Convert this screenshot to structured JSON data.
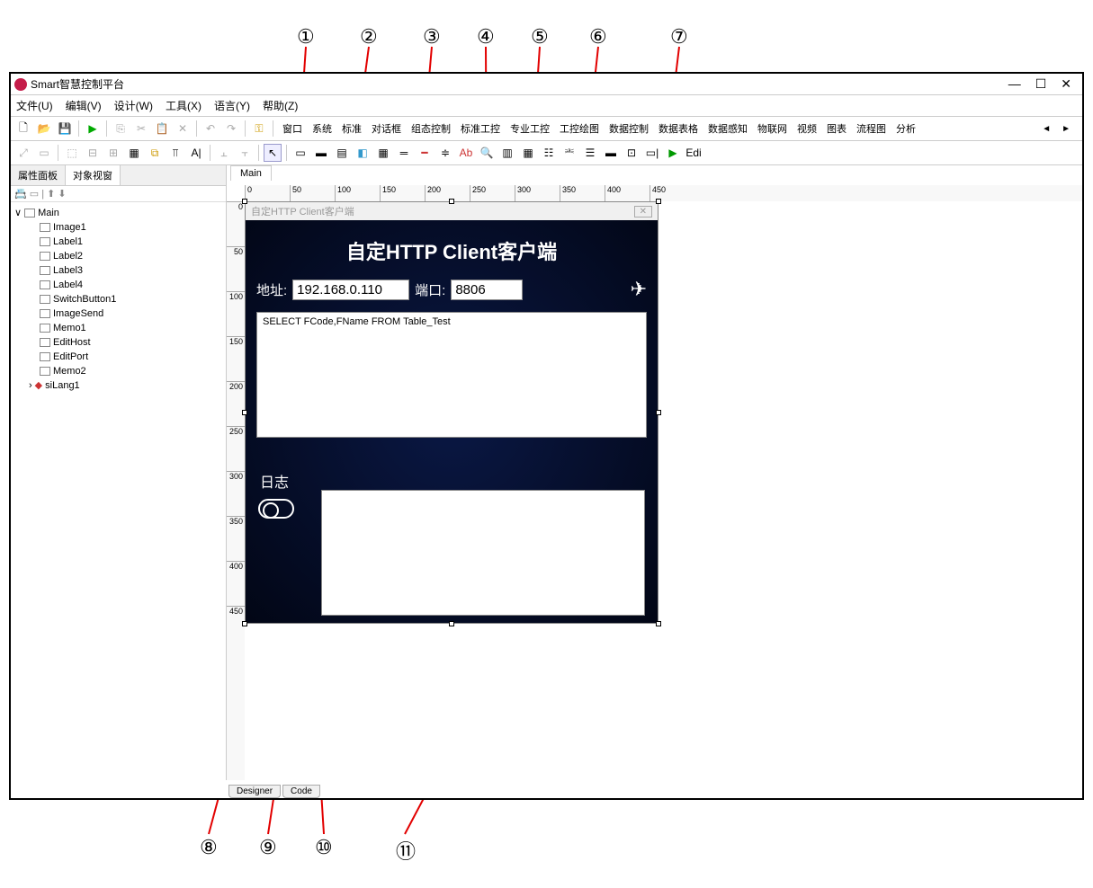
{
  "callouts_top": [
    "①",
    "②",
    "③",
    "④",
    "⑤",
    "⑥",
    "⑦"
  ],
  "callouts_bottom": [
    "⑧",
    "⑨",
    "⑩",
    "⑪"
  ],
  "app_title": "Smart智慧控制平台",
  "win_min": "—",
  "win_max": "☐",
  "win_close": "✕",
  "menu": [
    "文件(U)",
    "编辑(V)",
    "设计(W)",
    "工具(X)",
    "语言(Y)",
    "帮助(Z)"
  ],
  "palette": [
    "窗口",
    "系统",
    "标准",
    "对话框",
    "组态控制",
    "标准工控",
    "专业工控",
    "工控绘图",
    "数据控制",
    "数据表格",
    "数据感知",
    "物联网",
    "视频",
    "图表",
    "流程图",
    "分析"
  ],
  "left_tabs": {
    "props": "属性面板",
    "obj": "对象视窗"
  },
  "tree_root": "Main",
  "tree_items": [
    "Image1",
    "Label1",
    "Label2",
    "Label3",
    "Label4",
    "SwitchButton1",
    "ImageSend",
    "Memo1",
    "EditHost",
    "EditPort",
    "Memo2",
    "siLang1"
  ],
  "design_tab": "Main",
  "ruler_h": [
    "0",
    "50",
    "100",
    "150",
    "200",
    "250",
    "300",
    "350",
    "400",
    "450"
  ],
  "ruler_v": [
    "0",
    "50",
    "100",
    "150",
    "200",
    "250",
    "300",
    "350",
    "400",
    "450"
  ],
  "form_caption": "自定HTTP Client客户端",
  "form_title": "自定HTTP Client客户端",
  "label_addr": "地址:",
  "input_host": "192.168.0.110",
  "label_port": "端口:",
  "input_port": "8806",
  "memo1_text": "SELECT FCode,FName FROM Table_Test",
  "label_log": "日志",
  "bottom_tabs": {
    "designer": "Designer",
    "code": "Code"
  },
  "form_close": "✕"
}
